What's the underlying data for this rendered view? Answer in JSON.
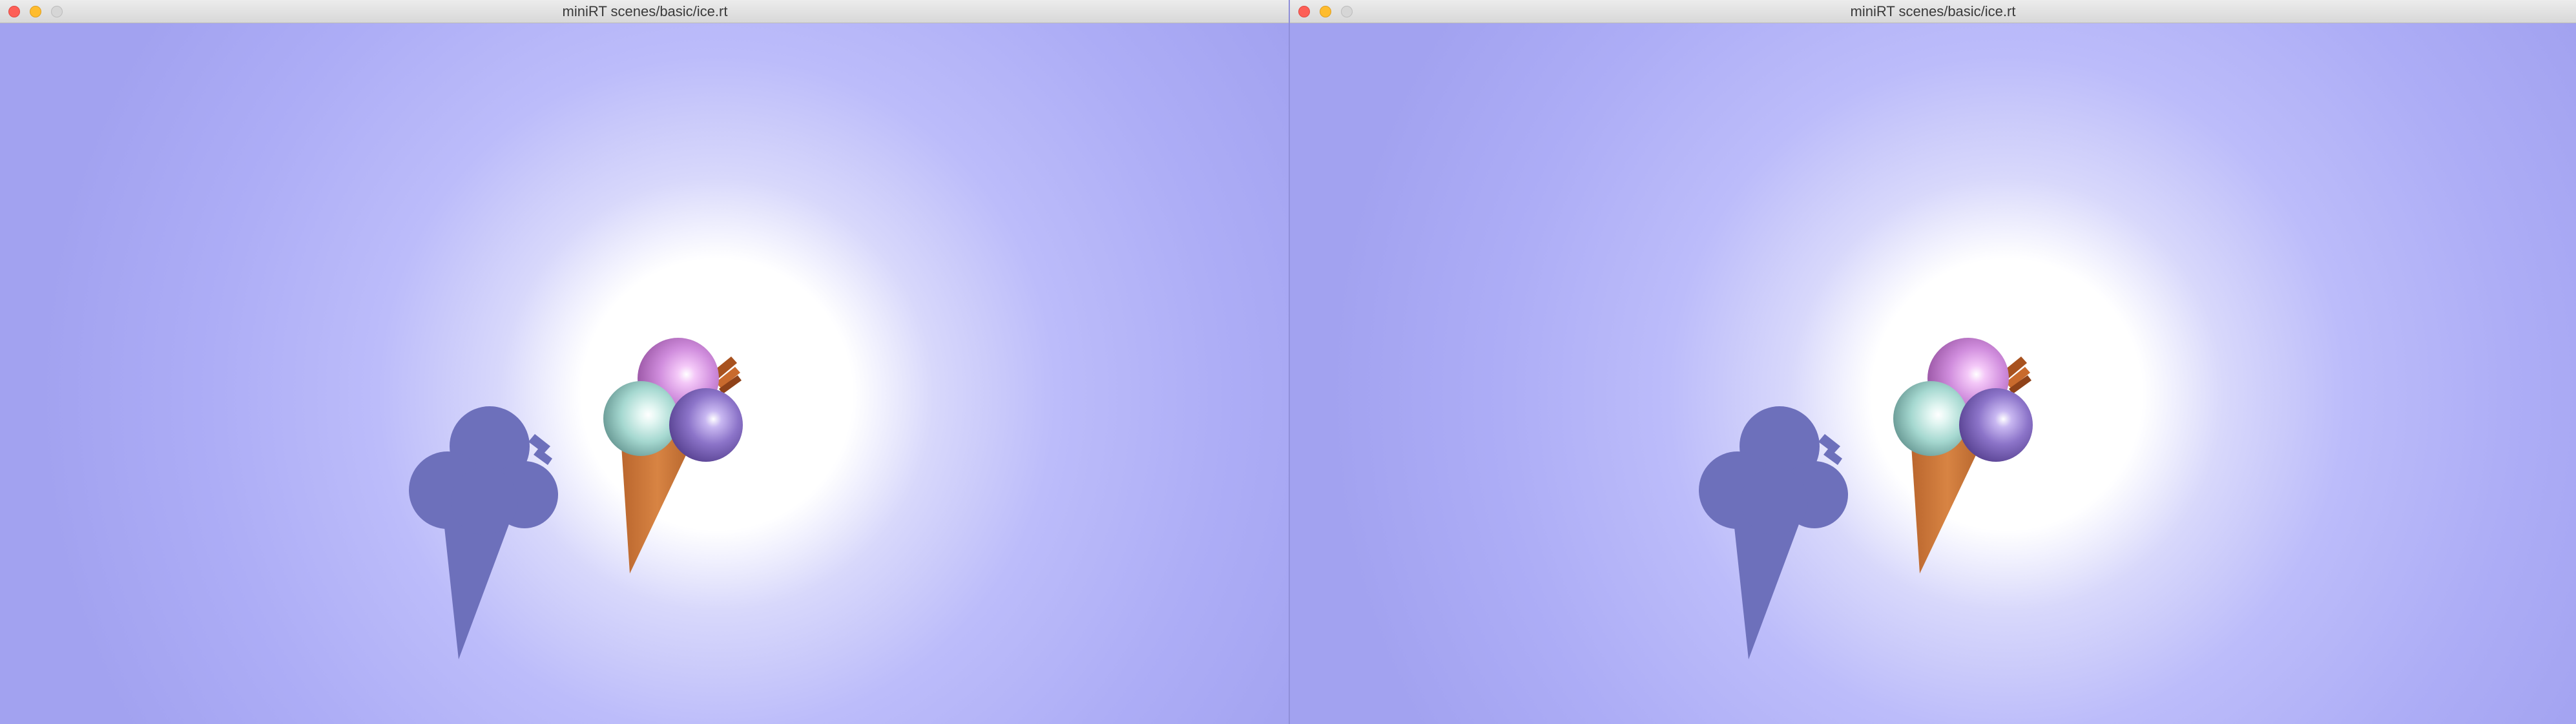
{
  "windows": [
    {
      "title": "miniRT scenes/basic/ice.rt",
      "controls": [
        "close-button",
        "minimize-button",
        "zoom-button"
      ]
    },
    {
      "title": "miniRT scenes/basic/ice.rt",
      "controls": [
        "close-button",
        "minimize-button",
        "zoom-button"
      ]
    }
  ],
  "scene": {
    "background_color": "#a3a3f2",
    "light_color": "#ffffff",
    "shadow_color": "#6d70bb",
    "cone_color": "#c9743a",
    "scoop_colors": [
      "#d58ee0",
      "#a9ddd6",
      "#8d76cc"
    ],
    "stick_color": "#a8521f"
  }
}
